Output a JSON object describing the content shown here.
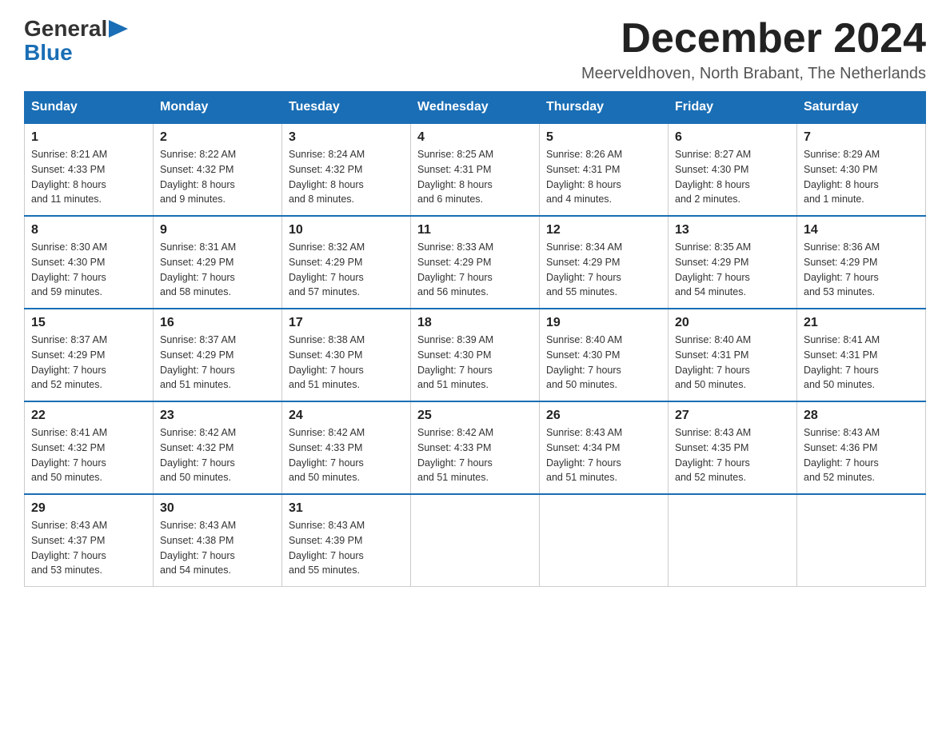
{
  "logo": {
    "general": "General",
    "blue": "Blue"
  },
  "title": {
    "month_year": "December 2024",
    "location": "Meerveldhoven, North Brabant, The Netherlands"
  },
  "days_of_week": [
    "Sunday",
    "Monday",
    "Tuesday",
    "Wednesday",
    "Thursday",
    "Friday",
    "Saturday"
  ],
  "weeks": [
    [
      {
        "day": "1",
        "sunrise": "8:21 AM",
        "sunset": "4:33 PM",
        "daylight": "8 hours and 11 minutes."
      },
      {
        "day": "2",
        "sunrise": "8:22 AM",
        "sunset": "4:32 PM",
        "daylight": "8 hours and 9 minutes."
      },
      {
        "day": "3",
        "sunrise": "8:24 AM",
        "sunset": "4:32 PM",
        "daylight": "8 hours and 8 minutes."
      },
      {
        "day": "4",
        "sunrise": "8:25 AM",
        "sunset": "4:31 PM",
        "daylight": "8 hours and 6 minutes."
      },
      {
        "day": "5",
        "sunrise": "8:26 AM",
        "sunset": "4:31 PM",
        "daylight": "8 hours and 4 minutes."
      },
      {
        "day": "6",
        "sunrise": "8:27 AM",
        "sunset": "4:30 PM",
        "daylight": "8 hours and 2 minutes."
      },
      {
        "day": "7",
        "sunrise": "8:29 AM",
        "sunset": "4:30 PM",
        "daylight": "8 hours and 1 minute."
      }
    ],
    [
      {
        "day": "8",
        "sunrise": "8:30 AM",
        "sunset": "4:30 PM",
        "daylight": "7 hours and 59 minutes."
      },
      {
        "day": "9",
        "sunrise": "8:31 AM",
        "sunset": "4:29 PM",
        "daylight": "7 hours and 58 minutes."
      },
      {
        "day": "10",
        "sunrise": "8:32 AM",
        "sunset": "4:29 PM",
        "daylight": "7 hours and 57 minutes."
      },
      {
        "day": "11",
        "sunrise": "8:33 AM",
        "sunset": "4:29 PM",
        "daylight": "7 hours and 56 minutes."
      },
      {
        "day": "12",
        "sunrise": "8:34 AM",
        "sunset": "4:29 PM",
        "daylight": "7 hours and 55 minutes."
      },
      {
        "day": "13",
        "sunrise": "8:35 AM",
        "sunset": "4:29 PM",
        "daylight": "7 hours and 54 minutes."
      },
      {
        "day": "14",
        "sunrise": "8:36 AM",
        "sunset": "4:29 PM",
        "daylight": "7 hours and 53 minutes."
      }
    ],
    [
      {
        "day": "15",
        "sunrise": "8:37 AM",
        "sunset": "4:29 PM",
        "daylight": "7 hours and 52 minutes."
      },
      {
        "day": "16",
        "sunrise": "8:37 AM",
        "sunset": "4:29 PM",
        "daylight": "7 hours and 51 minutes."
      },
      {
        "day": "17",
        "sunrise": "8:38 AM",
        "sunset": "4:30 PM",
        "daylight": "7 hours and 51 minutes."
      },
      {
        "day": "18",
        "sunrise": "8:39 AM",
        "sunset": "4:30 PM",
        "daylight": "7 hours and 51 minutes."
      },
      {
        "day": "19",
        "sunrise": "8:40 AM",
        "sunset": "4:30 PM",
        "daylight": "7 hours and 50 minutes."
      },
      {
        "day": "20",
        "sunrise": "8:40 AM",
        "sunset": "4:31 PM",
        "daylight": "7 hours and 50 minutes."
      },
      {
        "day": "21",
        "sunrise": "8:41 AM",
        "sunset": "4:31 PM",
        "daylight": "7 hours and 50 minutes."
      }
    ],
    [
      {
        "day": "22",
        "sunrise": "8:41 AM",
        "sunset": "4:32 PM",
        "daylight": "7 hours and 50 minutes."
      },
      {
        "day": "23",
        "sunrise": "8:42 AM",
        "sunset": "4:32 PM",
        "daylight": "7 hours and 50 minutes."
      },
      {
        "day": "24",
        "sunrise": "8:42 AM",
        "sunset": "4:33 PM",
        "daylight": "7 hours and 50 minutes."
      },
      {
        "day": "25",
        "sunrise": "8:42 AM",
        "sunset": "4:33 PM",
        "daylight": "7 hours and 51 minutes."
      },
      {
        "day": "26",
        "sunrise": "8:43 AM",
        "sunset": "4:34 PM",
        "daylight": "7 hours and 51 minutes."
      },
      {
        "day": "27",
        "sunrise": "8:43 AM",
        "sunset": "4:35 PM",
        "daylight": "7 hours and 52 minutes."
      },
      {
        "day": "28",
        "sunrise": "8:43 AM",
        "sunset": "4:36 PM",
        "daylight": "7 hours and 52 minutes."
      }
    ],
    [
      {
        "day": "29",
        "sunrise": "8:43 AM",
        "sunset": "4:37 PM",
        "daylight": "7 hours and 53 minutes."
      },
      {
        "day": "30",
        "sunrise": "8:43 AM",
        "sunset": "4:38 PM",
        "daylight": "7 hours and 54 minutes."
      },
      {
        "day": "31",
        "sunrise": "8:43 AM",
        "sunset": "4:39 PM",
        "daylight": "7 hours and 55 minutes."
      },
      null,
      null,
      null,
      null
    ]
  ],
  "labels": {
    "sunrise": "Sunrise:",
    "sunset": "Sunset:",
    "daylight": "Daylight:"
  }
}
